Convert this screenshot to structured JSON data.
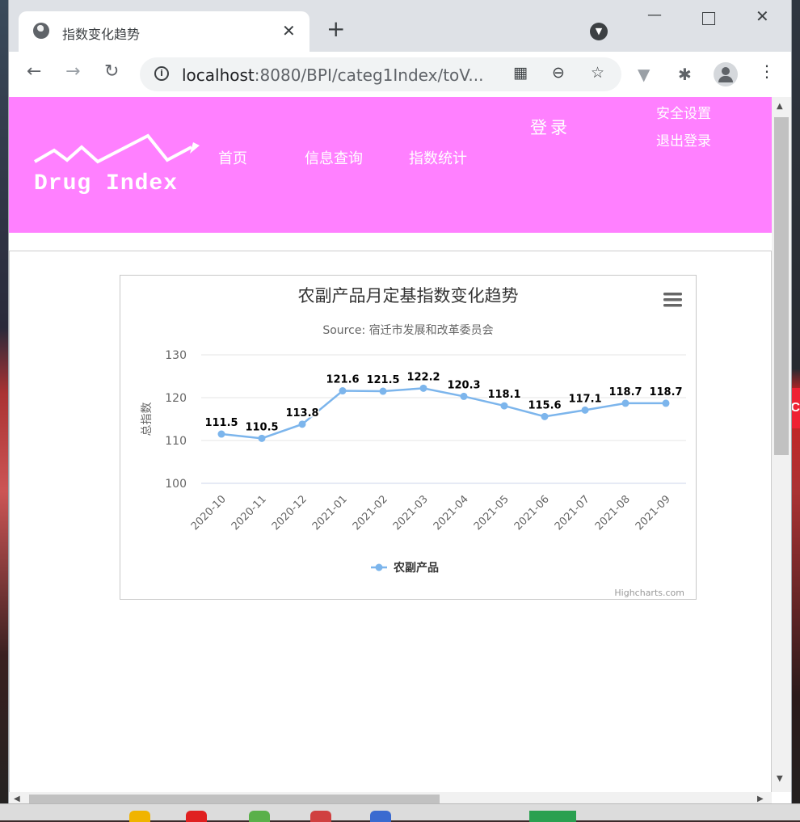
{
  "browser": {
    "tab_title": "指数变化趋势",
    "tab_close": "✕",
    "new_tab": "+",
    "url_host": "localhost",
    "url_rest": ":8080/BPI/categ1Index/toV...",
    "back": "←",
    "forward": "→",
    "reload": "↻",
    "min": "—",
    "close": "✕",
    "kebab": "⋮"
  },
  "site": {
    "logo": "Drug Index",
    "nav": [
      "首页",
      "信息查询",
      "指数统计"
    ],
    "login": "登录",
    "account_links": [
      "安全设置",
      "退出登录"
    ]
  },
  "chart": {
    "menu_icon": "hamburger-menu-icon",
    "credits": "Highcharts.com"
  },
  "chart_data": {
    "type": "line",
    "title": "农副产品月定基指数变化趋势",
    "subtitle": "Source: 宿迁市发展和改革委员会",
    "ylabel": "总指数",
    "xlabel": "",
    "ylim": [
      100,
      130
    ],
    "yticks": [
      100,
      110,
      120,
      130
    ],
    "grid": true,
    "legend": "bottom-center",
    "color": "#7cb5ec",
    "categories": [
      "2020-10",
      "2020-11",
      "2020-12",
      "2021-01",
      "2021-02",
      "2021-03",
      "2021-04",
      "2021-05",
      "2021-06",
      "2021-07",
      "2021-08",
      "2021-09"
    ],
    "series": [
      {
        "name": "农副产品",
        "values": [
          111.5,
          110.5,
          113.8,
          121.6,
          121.5,
          122.2,
          120.3,
          118.1,
          115.6,
          117.1,
          118.7,
          118.7
        ]
      }
    ]
  },
  "colors": {
    "header_bg": "#ff80ff",
    "series": "#7cb5ec"
  }
}
